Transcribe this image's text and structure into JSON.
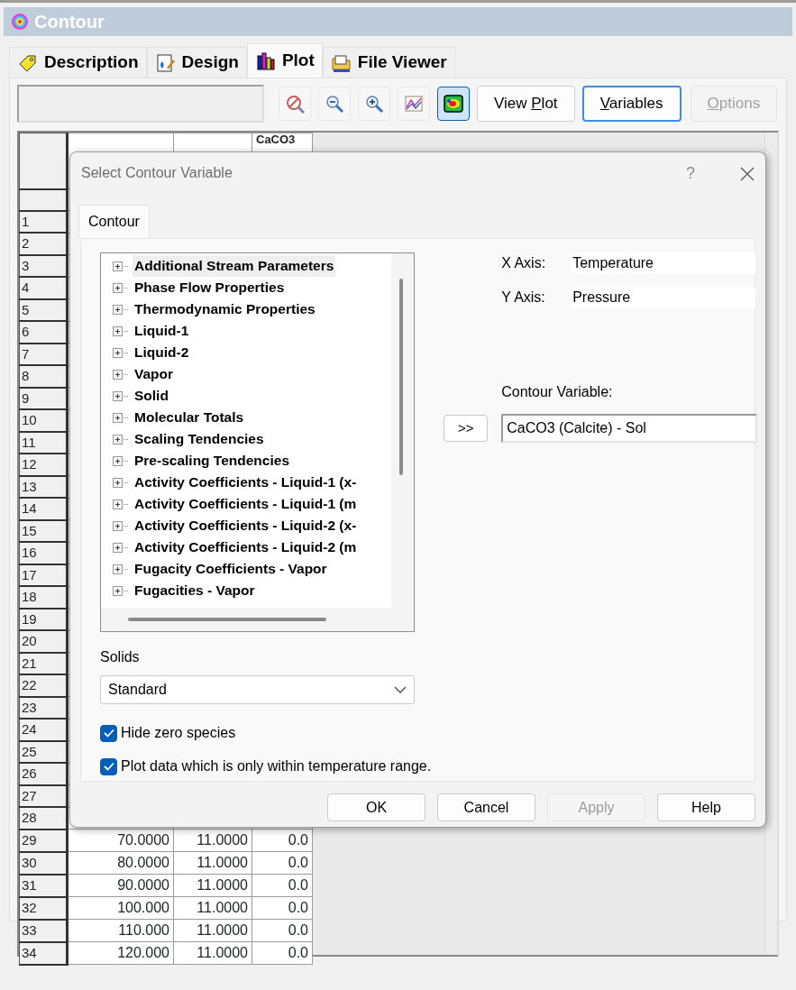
{
  "window": {
    "title": "Contour"
  },
  "tabs": [
    {
      "label": "Description",
      "kind": "tag",
      "selected": false
    },
    {
      "label": "Design",
      "kind": "design",
      "selected": false
    },
    {
      "label": "Plot",
      "kind": "chart",
      "selected": true
    },
    {
      "label": "File Viewer",
      "kind": "folder",
      "selected": false
    }
  ],
  "toolbar": {
    "icon_buttons": [
      {
        "kind": "no-zoom",
        "selected": false
      },
      {
        "kind": "zoom-out",
        "selected": false
      },
      {
        "kind": "zoom-in",
        "selected": false
      },
      {
        "kind": "line-plot",
        "selected": false
      },
      {
        "kind": "contour",
        "selected": true
      }
    ],
    "buttons": [
      {
        "before": "View ",
        "access_key": "P",
        "after": "lot",
        "focused": false,
        "disabled": false
      },
      {
        "access_key": "V",
        "after": "ariables",
        "focused": true,
        "disabled": false
      },
      {
        "access_key": "O",
        "after": "ptions",
        "focused": false,
        "disabled": true
      }
    ]
  },
  "grid": {
    "column_3": {
      "header": "CaCO3"
    },
    "rows": [
      {
        "number": "1"
      },
      {
        "number": "2"
      },
      {
        "number": "3"
      },
      {
        "number": "4"
      },
      {
        "number": "5"
      },
      {
        "number": "6"
      },
      {
        "number": "7"
      },
      {
        "number": "8"
      },
      {
        "number": "9"
      },
      {
        "number": "10"
      },
      {
        "number": "11"
      },
      {
        "number": "12"
      },
      {
        "number": "13"
      },
      {
        "number": "14"
      },
      {
        "number": "15"
      },
      {
        "number": "16"
      },
      {
        "number": "17"
      },
      {
        "number": "18"
      },
      {
        "number": "19"
      },
      {
        "number": "20"
      },
      {
        "number": "21"
      },
      {
        "number": "22"
      },
      {
        "number": "23"
      },
      {
        "number": "24"
      },
      {
        "number": "25"
      },
      {
        "number": "26"
      },
      {
        "number": "27"
      },
      {
        "number": "28"
      },
      {
        "number": "29",
        "cells": [
          "70.0000",
          "11.0000",
          "0.0"
        ]
      },
      {
        "number": "30",
        "cells": [
          "80.0000",
          "11.0000",
          "0.0"
        ]
      },
      {
        "number": "31",
        "cells": [
          "90.0000",
          "11.0000",
          "0.0"
        ]
      },
      {
        "number": "32",
        "cells": [
          "100.000",
          "11.0000",
          "0.0"
        ]
      },
      {
        "number": "33",
        "cells": [
          "110.000",
          "11.0000",
          "0.0"
        ]
      },
      {
        "number": "34",
        "cells": [
          "120.000",
          "11.0000",
          "0.0"
        ]
      }
    ]
  },
  "dialog": {
    "title": "Select Contour Variable",
    "help": "?",
    "tabs": [
      {
        "label": "Contour",
        "selected": true
      }
    ],
    "tree": [
      {
        "label": "Additional Stream Parameters",
        "expanded": false,
        "selected": true
      },
      {
        "label": "Phase Flow Properties",
        "expanded": false,
        "selected": false
      },
      {
        "label": "Thermodynamic Properties",
        "expanded": false,
        "selected": false
      },
      {
        "label": "Liquid-1",
        "expanded": false,
        "selected": false
      },
      {
        "label": "Liquid-2",
        "expanded": false,
        "selected": false
      },
      {
        "label": "Vapor",
        "expanded": false,
        "selected": false
      },
      {
        "label": "Solid",
        "expanded": false,
        "selected": false
      },
      {
        "label": "Molecular Totals",
        "expanded": false,
        "selected": false
      },
      {
        "label": "Scaling Tendencies",
        "expanded": false,
        "selected": false
      },
      {
        "label": "Pre-scaling Tendencies",
        "expanded": false,
        "selected": false
      },
      {
        "label": "Activity Coefficients - Liquid-1 (x-",
        "expanded": false,
        "selected": false
      },
      {
        "label": "Activity Coefficients - Liquid-1 (m",
        "expanded": false,
        "selected": false
      },
      {
        "label": "Activity Coefficients - Liquid-2 (x-",
        "expanded": false,
        "selected": false
      },
      {
        "label": "Activity Coefficients - Liquid-2 (m",
        "expanded": false,
        "selected": false
      },
      {
        "label": "Fugacity Coefficients - Vapor",
        "expanded": false,
        "selected": false
      },
      {
        "label": "Fugacities - Vapor",
        "expanded": false,
        "selected": false
      }
    ],
    "axes": [
      {
        "label": "X Axis:",
        "value": "Temperature"
      },
      {
        "label": "Y Axis:",
        "value": "Pressure"
      }
    ],
    "add_button": ">>",
    "contour_variable": {
      "label": "Contour Variable:",
      "value": "CaCO3 (Calcite) - Sol"
    },
    "solids": {
      "label": "Solids",
      "value": "Standard"
    },
    "checkboxes": [
      {
        "label": "Hide zero species",
        "checked": true
      },
      {
        "label": "Plot data which is only within temperature range.",
        "checked": true
      }
    ],
    "buttons": [
      {
        "label": "OK",
        "disabled": false
      },
      {
        "label": "Cancel",
        "disabled": false
      },
      {
        "label": "Apply",
        "disabled": true
      },
      {
        "label": "Help",
        "disabled": false
      }
    ]
  }
}
